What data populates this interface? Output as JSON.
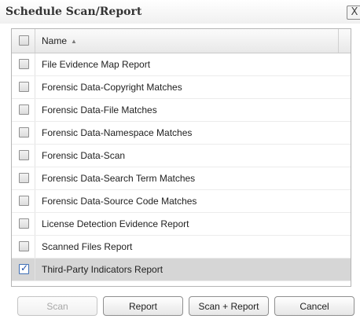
{
  "dialog": {
    "title": "Schedule Scan/Report",
    "close_label": "X"
  },
  "grid": {
    "header": {
      "name": "Name",
      "sort_icon": "sort-ascending-icon",
      "sort_glyph": "▲"
    },
    "rows": [
      {
        "label": "File Evidence Map Report",
        "checked": false
      },
      {
        "label": "Forensic Data-Copyright Matches",
        "checked": false
      },
      {
        "label": "Forensic Data-File Matches",
        "checked": false
      },
      {
        "label": "Forensic Data-Namespace Matches",
        "checked": false
      },
      {
        "label": "Forensic Data-Scan",
        "checked": false
      },
      {
        "label": "Forensic Data-Search Term Matches",
        "checked": false
      },
      {
        "label": "Forensic Data-Source Code Matches",
        "checked": false
      },
      {
        "label": "License Detection Evidence Report",
        "checked": false
      },
      {
        "label": "Scanned Files Report",
        "checked": false
      },
      {
        "label": "Third-Party Indicators Report",
        "checked": true
      }
    ]
  },
  "buttons": {
    "scan": "Scan",
    "report": "Report",
    "scan_report": "Scan + Report",
    "cancel": "Cancel"
  },
  "colors": {
    "selected_row": "#d6d6d6",
    "checkmark": "#1f4fa8"
  }
}
